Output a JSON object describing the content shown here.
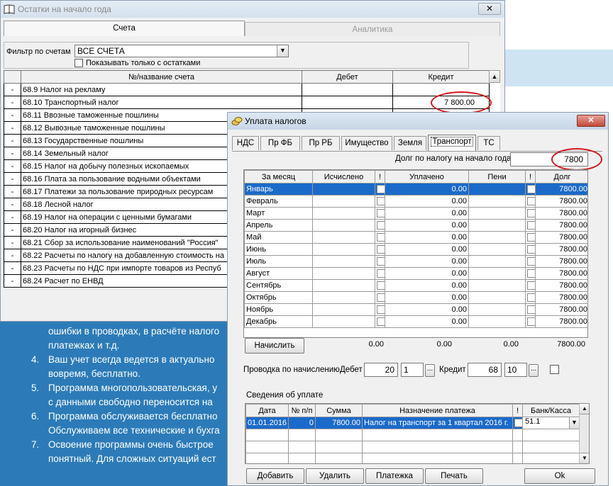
{
  "bg_article": {
    "lines": [
      "ошибки в проводках, в расчёте налого",
      "платежках и т.д.",
      "Ваш учет всегда ведется в актуально",
      "вовремя, бесплатно.",
      "Программа многопользовательская, у",
      "с данными свободно переносится на",
      "Программа обслуживается бесплатно",
      "Обслуживаем все технические и бухга",
      "Освоение программы очень быстрое",
      "понятный. Для сложных ситуаций ест"
    ],
    "numbers": [
      "4.",
      "5.",
      "6.",
      "7."
    ]
  },
  "win_ostatki": {
    "title": "Остатки на начало года",
    "tab_accounts": "Счета",
    "tab_analytics": "Аналитика",
    "filter_label": "Фильтр по счетам",
    "filter_value": "ВСЕ СЧЕТА",
    "only_balance_label": "Показывать только с остатками",
    "headers": {
      "num": "№/название счета",
      "debit": "Дебет",
      "credit": "Кредит"
    },
    "rows": [
      {
        "m": "-",
        "name": "68.9  Налог на рекламу",
        "debit": "",
        "credit": ""
      },
      {
        "m": "-",
        "name": "68.10  Транспортный налог",
        "debit": "",
        "credit": "7 800.00"
      },
      {
        "m": "-",
        "name": "68.11  Ввозные таможенные пошлины",
        "debit": "",
        "credit": ""
      },
      {
        "m": "-",
        "name": "68.12  Вывозные таможенные пошлины",
        "debit": "",
        "credit": ""
      },
      {
        "m": "-",
        "name": "68.13  Государственные пошлины",
        "debit": "",
        "credit": ""
      },
      {
        "m": "-",
        "name": "68.14  Земельный налог",
        "debit": "",
        "credit": ""
      },
      {
        "m": "-",
        "name": "68.15  Налог на добычу полезных ископаемых",
        "debit": "",
        "credit": ""
      },
      {
        "m": "-",
        "name": "68.16  Плата за пользование водными объектами",
        "debit": "",
        "credit": ""
      },
      {
        "m": "-",
        "name": "68.17  Платежи за пользование природных ресурсам",
        "debit": "",
        "credit": ""
      },
      {
        "m": "-",
        "name": "68.18  Лесной налог",
        "debit": "",
        "credit": ""
      },
      {
        "m": "-",
        "name": "68.19  Налог на операции с ценными бумагами",
        "debit": "",
        "credit": ""
      },
      {
        "m": "-",
        "name": "68.20  Налог на игорный бизнес",
        "debit": "",
        "credit": ""
      },
      {
        "m": "-",
        "name": "68.21  Сбор за использование наименований \"Россия\"",
        "debit": "",
        "credit": ""
      },
      {
        "m": "-",
        "name": "68.22  Расчеты по налогу на добавленную стоимость на",
        "debit": "",
        "credit": ""
      },
      {
        "m": "-",
        "name": "68.23  Расчеты по НДС при импорте товаров из Респуб",
        "debit": "",
        "credit": ""
      },
      {
        "m": "-",
        "name": "68.24  Расчет по ЕНВД",
        "debit": "",
        "credit": ""
      }
    ]
  },
  "win_uplata": {
    "title": "Уплата налогов",
    "tabs": [
      "НДС",
      "Пр ФБ",
      "Пр РБ",
      "Имущество",
      "Земля",
      "Транспорт",
      "ТС"
    ],
    "active_tab": "Транспорт",
    "debt_label": "Долг по налогу на начало года",
    "debt_value": "7800",
    "headers": {
      "month": "За месяц",
      "calc": "Исчислено",
      "flag": "!",
      "paid": "Уплачено",
      "peni": "Пени",
      "flag2": "!",
      "debt": "Долг"
    },
    "months": [
      {
        "month": "Январь",
        "calc": "",
        "paid": "0.00",
        "peni": "",
        "debt": "7800.00"
      },
      {
        "month": "Февраль",
        "calc": "",
        "paid": "0.00",
        "peni": "",
        "debt": "7800.00"
      },
      {
        "month": "Март",
        "calc": "",
        "paid": "0.00",
        "peni": "",
        "debt": "7800.00"
      },
      {
        "month": "Апрель",
        "calc": "",
        "paid": "0.00",
        "peni": "",
        "debt": "7800.00"
      },
      {
        "month": "Май",
        "calc": "",
        "paid": "0.00",
        "peni": "",
        "debt": "7800.00"
      },
      {
        "month": "Июнь",
        "calc": "",
        "paid": "0.00",
        "peni": "",
        "debt": "7800.00"
      },
      {
        "month": "Июль",
        "calc": "",
        "paid": "0.00",
        "peni": "",
        "debt": "7800.00"
      },
      {
        "month": "Август",
        "calc": "",
        "paid": "0.00",
        "peni": "",
        "debt": "7800.00"
      },
      {
        "month": "Сентябрь",
        "calc": "",
        "paid": "0.00",
        "peni": "",
        "debt": "7800.00"
      },
      {
        "month": "Октябрь",
        "calc": "",
        "paid": "0.00",
        "peni": "",
        "debt": "7800.00"
      },
      {
        "month": "Ноябрь",
        "calc": "",
        "paid": "0.00",
        "peni": "",
        "debt": "7800.00"
      },
      {
        "month": "Декабрь",
        "calc": "",
        "paid": "0.00",
        "peni": "",
        "debt": "7800.00"
      }
    ],
    "accrue_button": "Начислить",
    "totals": {
      "calc": "0.00",
      "paid": "0.00",
      "peni": "0.00",
      "debt": "7800.00"
    },
    "posting_label": "Проводка  по начислению",
    "debit_label": "Дебет",
    "debit_account": "20",
    "debit_sub": "1",
    "credit_label": "Кредит",
    "credit_account": "68",
    "credit_sub": "10",
    "ellipsis": "...",
    "payments_label": "Сведения об уплате",
    "pay_headers": {
      "date": "Дата",
      "no": "№ п/п",
      "sum": "Сумма",
      "purpose": "Назначение платежа",
      "flag": "!",
      "bank": "Банк/Касса"
    },
    "payments": [
      {
        "date": "01.01.2016",
        "no": "0",
        "sum": "7800.00",
        "purpose": "Налог на транспорт за 1 квартал 2016 г.",
        "bank": "51.1"
      }
    ],
    "buttons": {
      "add": "Добавить",
      "delete": "Удалить",
      "payment": "Платежка",
      "print": "Печать",
      "ok": "Ok"
    }
  }
}
